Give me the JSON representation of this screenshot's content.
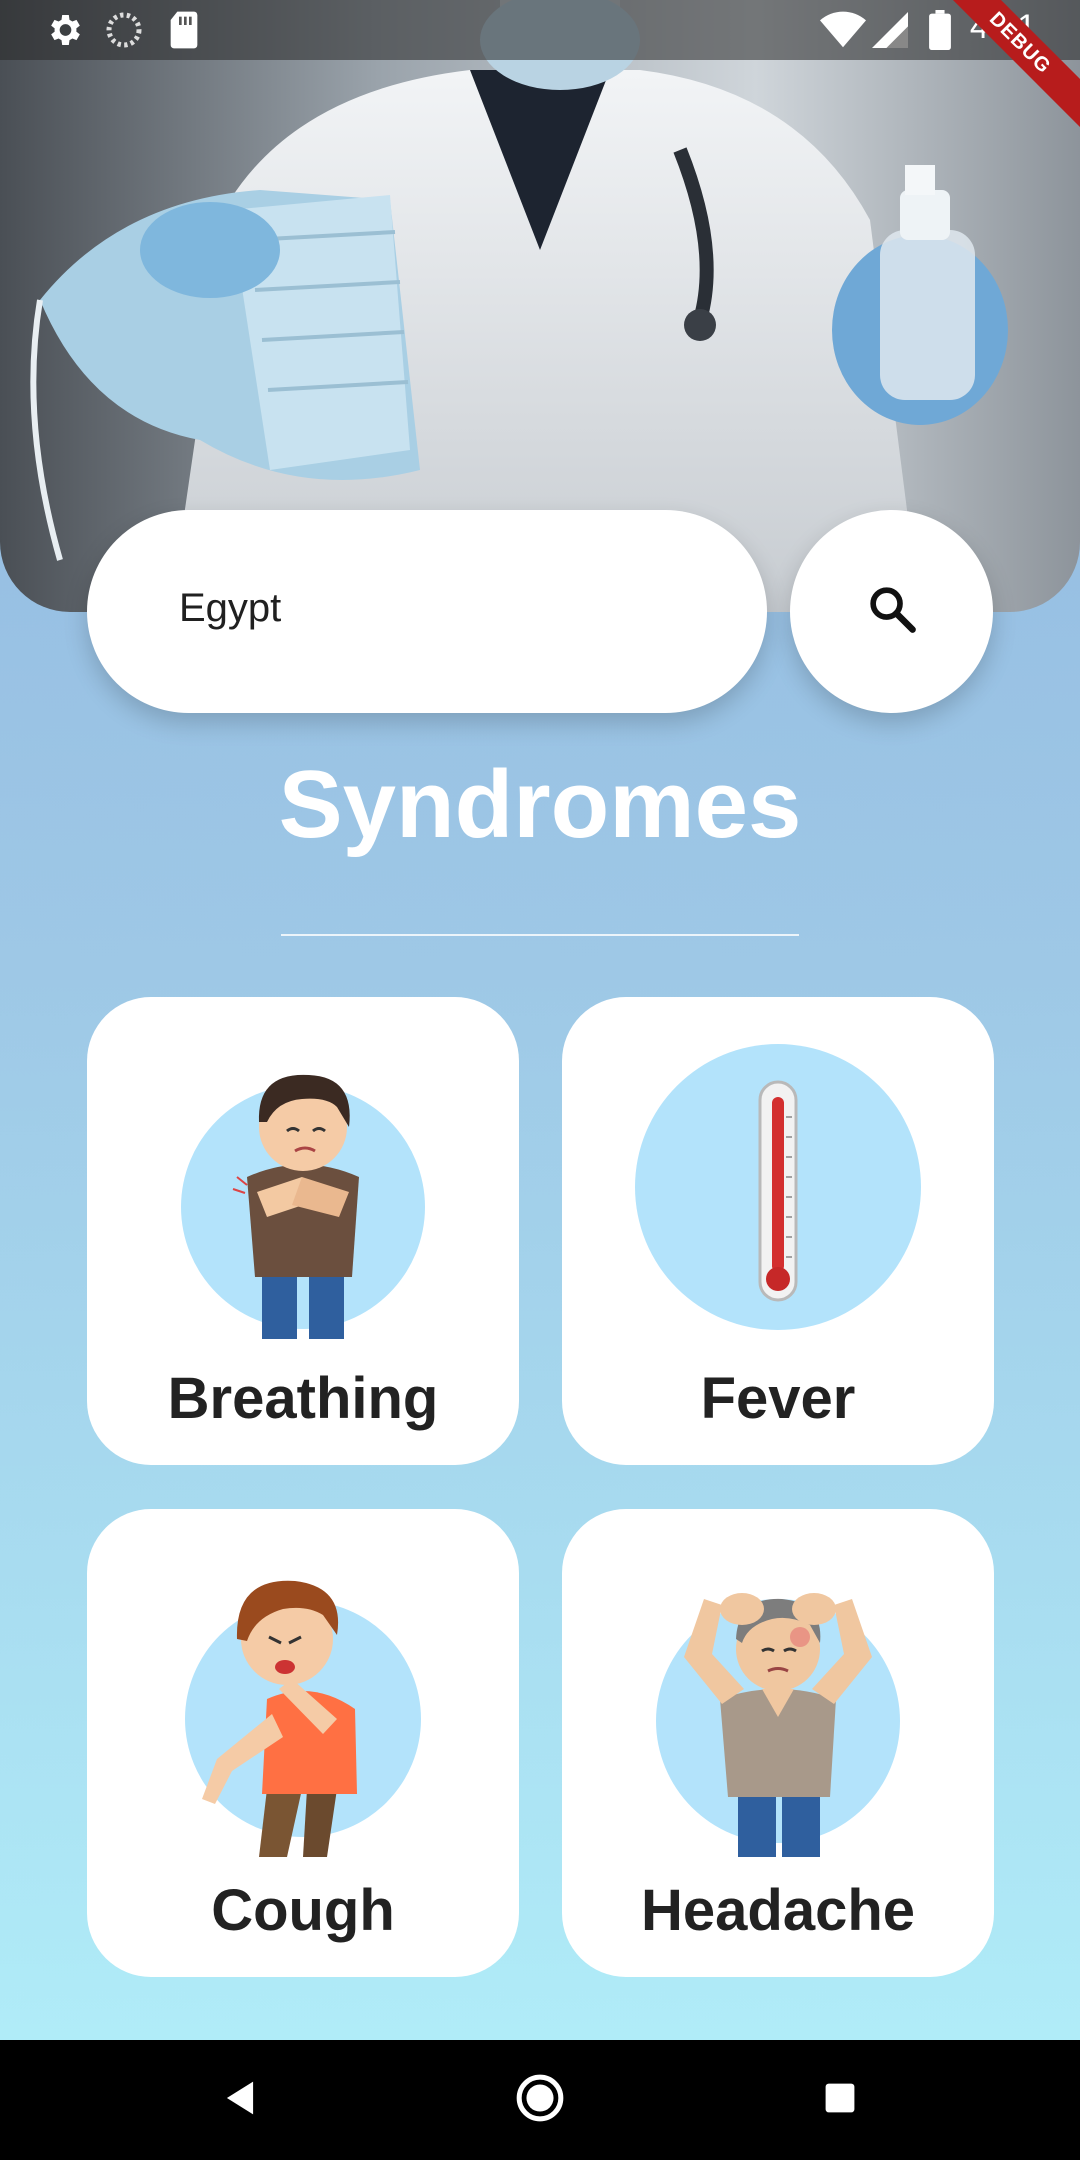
{
  "status_bar": {
    "time": "4:51",
    "left_icons": [
      "settings-icon",
      "sync-icon",
      "sd-card-icon"
    ],
    "right_icons": [
      "wifi-icon",
      "signal-icon",
      "battery-icon"
    ],
    "debug_label": "DEBUG"
  },
  "hero": {
    "image": "doctor-holding-mask-and-sanitizer"
  },
  "search": {
    "value": "Egypt",
    "button_icon": "search-icon"
  },
  "section": {
    "title": "Syndromes"
  },
  "cards": [
    {
      "label": "Breathing",
      "icon": "breathing-boy-illustration"
    },
    {
      "label": "Fever",
      "icon": "thermometer-illustration"
    },
    {
      "label": "Cough",
      "icon": "coughing-boy-illustration"
    },
    {
      "label": "Headache",
      "icon": "headache-man-illustration"
    }
  ],
  "nav": [
    "back-icon",
    "home-icon",
    "recents-icon"
  ],
  "colors": {
    "accent_circle": "#b3e3fb",
    "bg_top": "#8fb5df",
    "bg_bottom": "#b2f0fa"
  }
}
